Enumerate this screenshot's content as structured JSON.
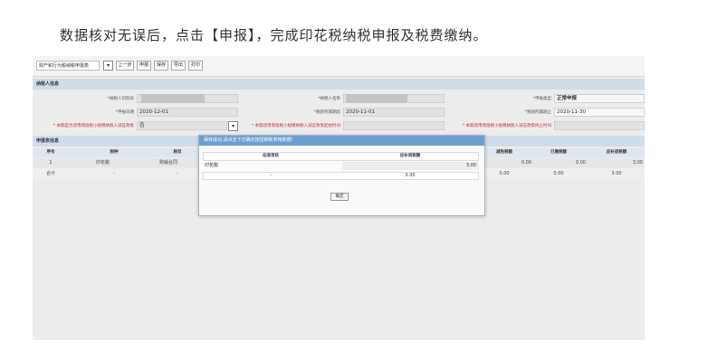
{
  "caption": "数据核对无误后，点击【申报】，完成印花税纳税申报及税费缴纳。",
  "toolbar": {
    "form_select": "财产和行为税纳税申报表",
    "buttons": [
      "上一步",
      "申报",
      "保存",
      "导出",
      "打印"
    ]
  },
  "taxpayer": {
    "section_title": "纳税人信息",
    "id_label": "*纳税人识别号",
    "name_label": "*纳税人名称",
    "type_label": "*申报类型",
    "type_value": "正常申报",
    "date_label": "*申报日期",
    "date_value": "2020-12-01",
    "period_start_label": "*税款所属期起",
    "period_start_value": "2020-11-01",
    "period_end_label": "*税款所属期止",
    "period_end_value": "2020-11-30",
    "q1_label": "* 本期是否适用增值税小规模纳税人减征政策",
    "q1_value": "否",
    "q2_label": "* 本期适用增值税小规模纳税人减征政策起始时间",
    "q3_label": "* 本期适用增值税小规模纳税人减征政策终止时间"
  },
  "declaration": {
    "section_title": "申报表信息",
    "headers": [
      "序号",
      "税种",
      "税目",
      "减免税额",
      "已缴税额",
      "应补退税额"
    ],
    "row": [
      "1",
      "印花税",
      "购销合同",
      "0.00",
      "0.00",
      "3.00"
    ],
    "total": [
      "合计",
      "-",
      "-",
      "0.00",
      "0.00",
      "3.00"
    ]
  },
  "modal": {
    "title": "保存成功,请点击下方确定按钮刷新表格数据!",
    "headers": [
      "征收项目",
      "应补退税额"
    ],
    "rows": [
      [
        "印花税",
        "3.00"
      ],
      [
        "-",
        "3.00"
      ]
    ],
    "confirm": "确定"
  }
}
